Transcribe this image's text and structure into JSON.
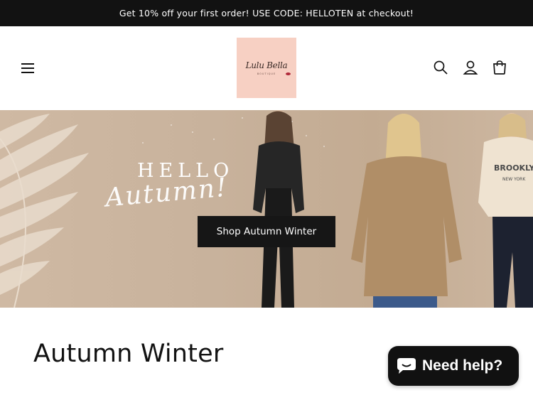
{
  "announcement": {
    "text": "Get 10% off your first order! USE CODE: HELLOTEN at checkout!"
  },
  "header": {
    "menu_icon": "hamburger-menu-icon",
    "logo": {
      "script": "Lulu Bella",
      "sub": "BOUTIQUE"
    },
    "icons": [
      "search-icon",
      "account-icon",
      "cart-icon"
    ]
  },
  "hero": {
    "headline": "HELLO",
    "script_text": "Autumn!",
    "cta_label": "Shop Autumn Winter",
    "sweatshirt_text": "BROOKLYN",
    "sweatshirt_sub": "NEW YORK"
  },
  "collection": {
    "title": "Autumn Winter"
  },
  "chat": {
    "label": "Need help?",
    "icon": "chat-bubble-icon"
  },
  "colors": {
    "announcement_bg": "#121212",
    "hero_bg": "#c8b29c",
    "logo_bg": "#f7d0c3",
    "button_bg": "#161616"
  }
}
